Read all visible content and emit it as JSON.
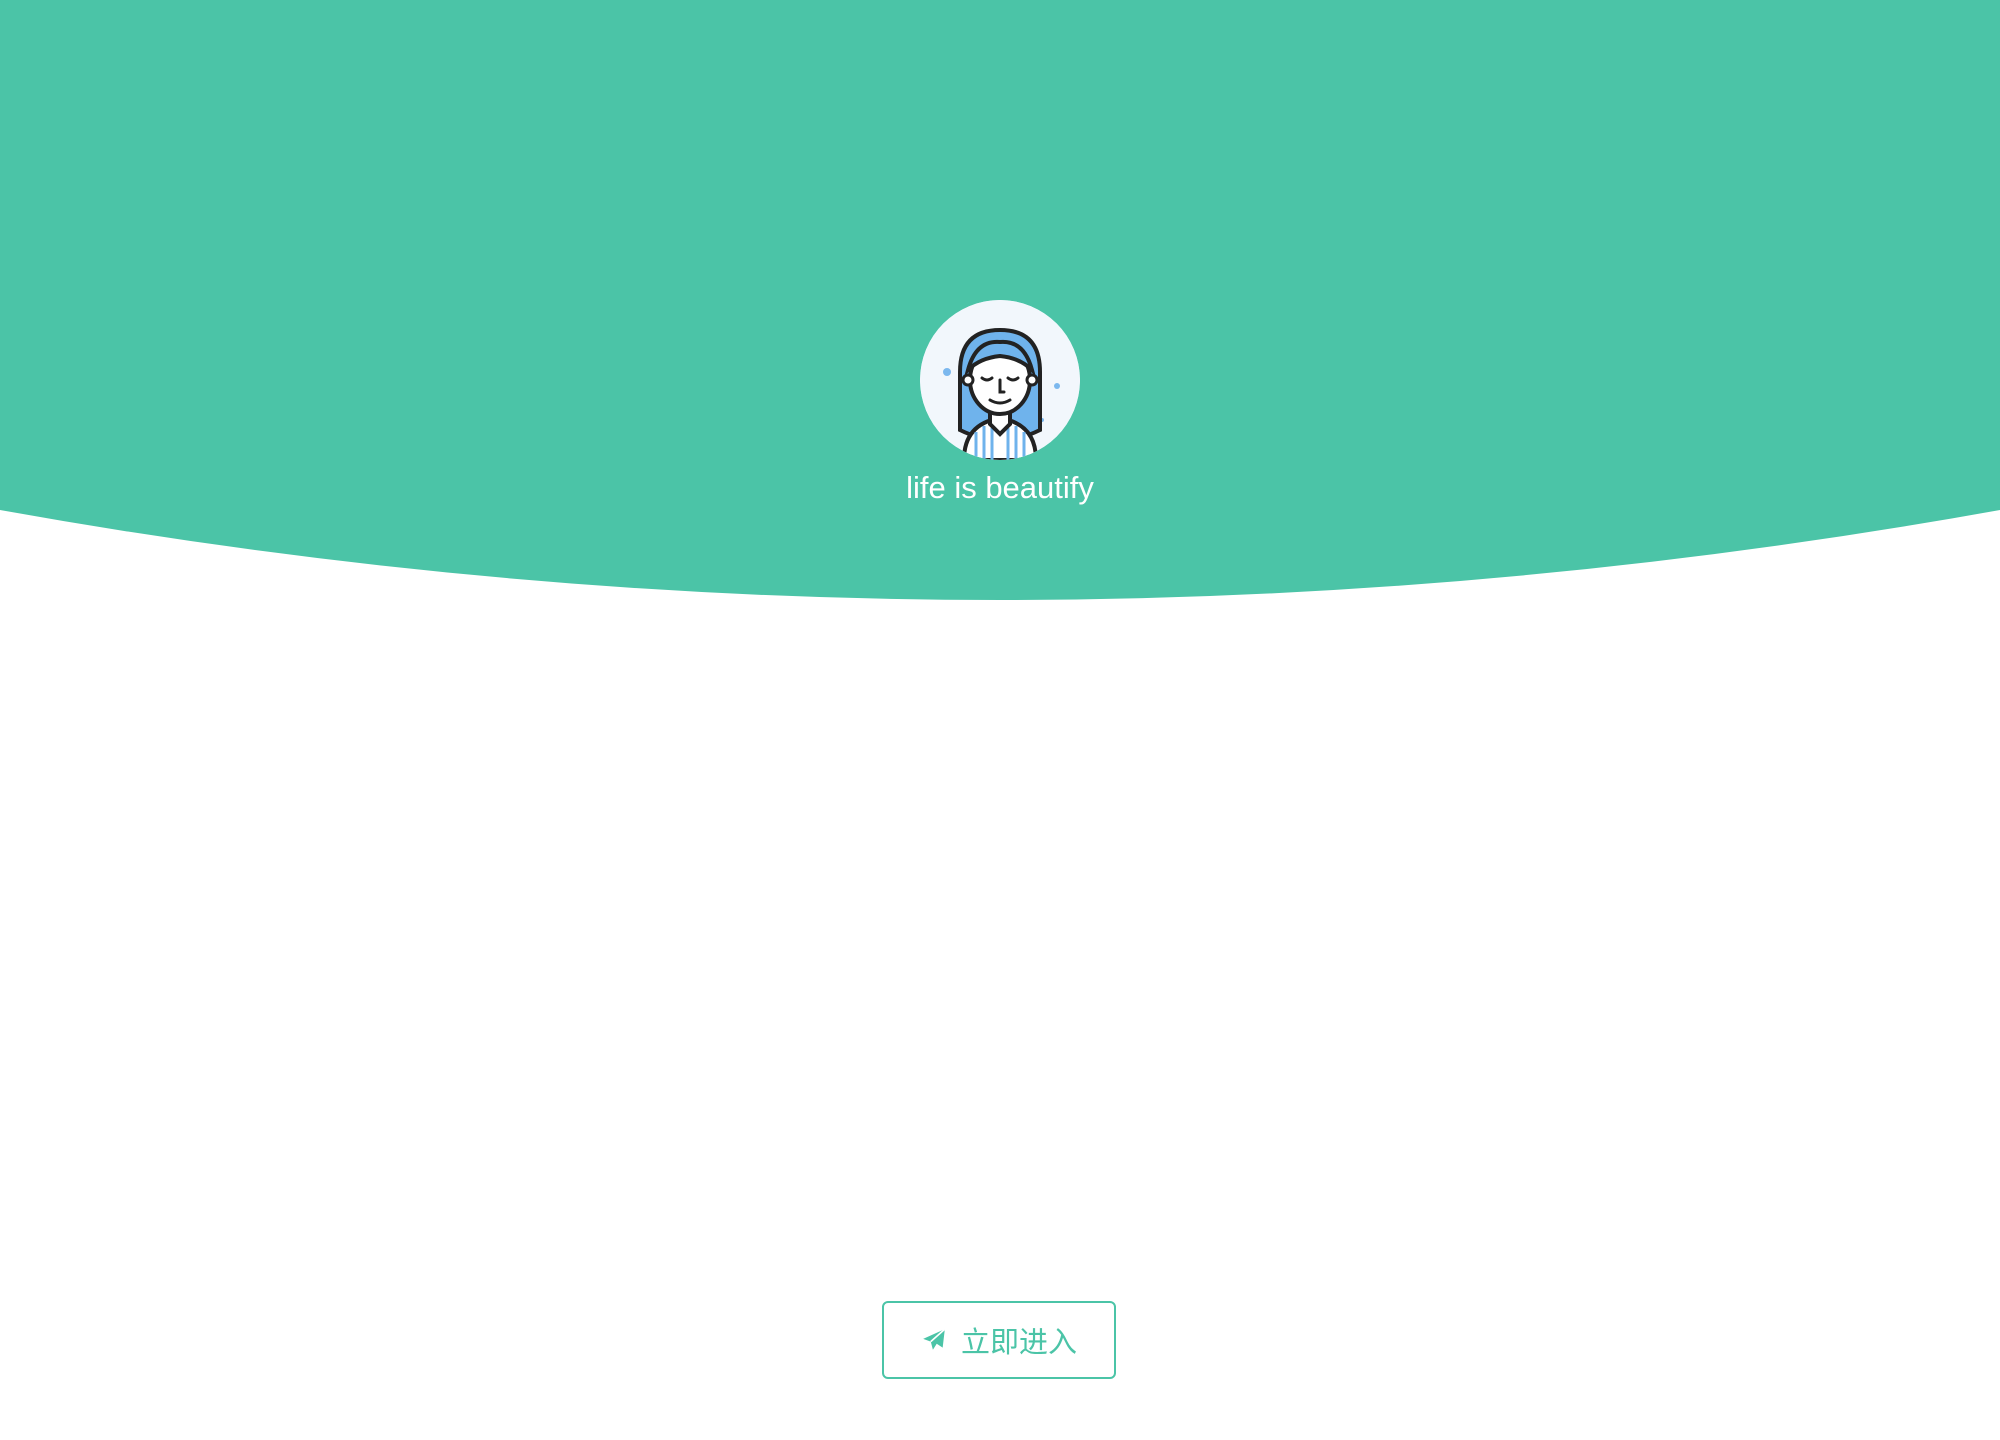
{
  "hero": {
    "tagline": "life is beautify",
    "background_color": "#4bc4a7"
  },
  "avatar": {
    "icon": "woman-avatar-icon"
  },
  "enter_button": {
    "label": "立即进入",
    "icon": "paper-plane-icon",
    "color": "#4bc4a7"
  }
}
